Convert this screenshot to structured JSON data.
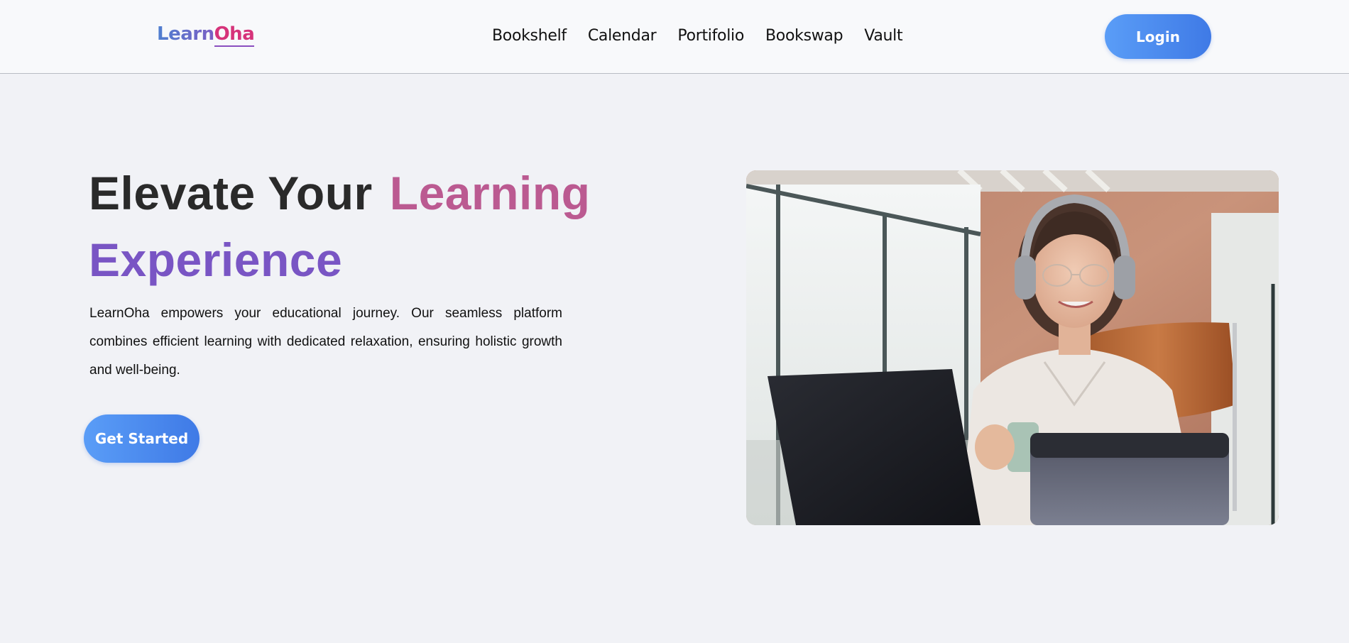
{
  "header": {
    "logo": {
      "part1": "Learn",
      "part2": "Oha"
    },
    "nav": [
      "Bookshelf",
      "Calendar",
      "Portifolio",
      "Bookswap",
      "Vault"
    ],
    "login_label": "Login"
  },
  "hero": {
    "headline": {
      "line1_dark": "Elevate Your",
      "line1_accent": "Learning",
      "line2": "Experience"
    },
    "description": "LearnOha empowers your educational journey. Our seamless platform combines efficient learning with dedicated relaxation, ensuring holistic growth and well-being.",
    "cta_label": "Get Started",
    "image": "photo-woman-with-headphones-at-laptop"
  },
  "colors": {
    "accent_blue": "#4a8cf0",
    "headline_pink": "#bb5a91",
    "headline_purple": "#7955c4",
    "background": "#f1f2f6"
  }
}
